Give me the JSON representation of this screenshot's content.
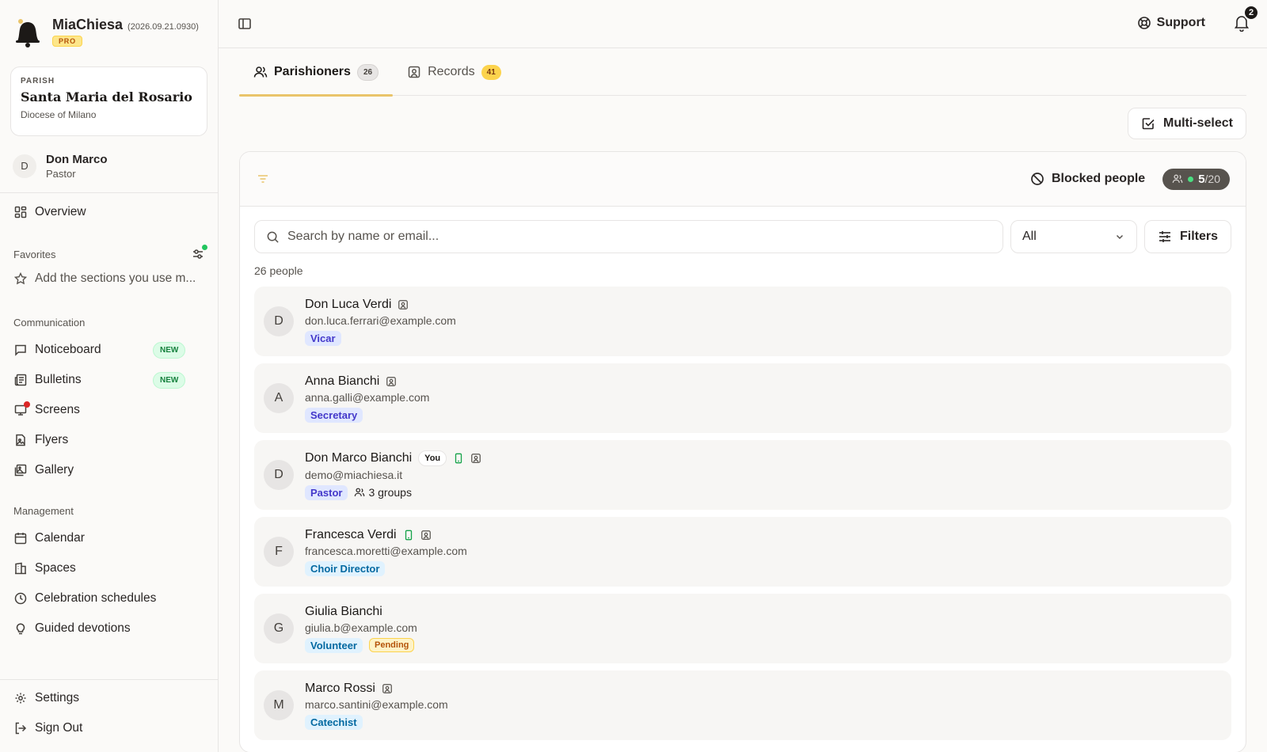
{
  "app": {
    "name": "MiaChiesa",
    "version": "(2026.09.21.0930)",
    "plan": "PRO"
  },
  "parish": {
    "label": "PARISH",
    "name": "Santa Maria del Rosario",
    "diocese": "Diocese of Milano"
  },
  "user": {
    "initial": "D",
    "name": "Don Marco",
    "role": "Pastor"
  },
  "sidebar": {
    "overview": "Overview",
    "favorites_label": "Favorites",
    "favorites_placeholder": "Add the sections you use m...",
    "communication_label": "Communication",
    "communication": [
      {
        "label": "Noticeboard",
        "badge": "NEW"
      },
      {
        "label": "Bulletins",
        "badge": "NEW"
      },
      {
        "label": "Screens"
      },
      {
        "label": "Flyers"
      },
      {
        "label": "Gallery"
      }
    ],
    "management_label": "Management",
    "management": [
      {
        "label": "Calendar"
      },
      {
        "label": "Spaces"
      },
      {
        "label": "Celebration schedules"
      },
      {
        "label": "Guided devotions"
      }
    ],
    "settings": "Settings",
    "sign_out": "Sign Out"
  },
  "topbar": {
    "support": "Support",
    "notifications": "2"
  },
  "tabs": [
    {
      "label": "Parishioners",
      "count": "26"
    },
    {
      "label": "Records",
      "count": "41"
    }
  ],
  "toolbar": {
    "multi_select": "Multi-select"
  },
  "panel": {
    "blocked_label": "Blocked people",
    "quota_used": "5",
    "quota_total": "/20",
    "search_placeholder": "Search by name or email...",
    "filter_value": "All",
    "filters_label": "Filters",
    "count_text": "26 people"
  },
  "people": [
    {
      "initial": "D",
      "name": "Don Luca Verdi",
      "email": "don.luca.ferrari@example.com",
      "role": "Vicar"
    },
    {
      "initial": "A",
      "name": "Anna Bianchi",
      "email": "anna.galli@example.com",
      "role": "Secretary"
    },
    {
      "initial": "D",
      "name": "Don Marco Bianchi",
      "you": "You",
      "email": "demo@miachiesa.it",
      "role": "Pastor",
      "groups": "3 groups"
    },
    {
      "initial": "F",
      "name": "Francesca Verdi",
      "email": "francesca.moretti@example.com",
      "role": "Choir Director"
    },
    {
      "initial": "G",
      "name": "Giulia Bianchi",
      "email": "giulia.b@example.com",
      "role": "Volunteer",
      "status": "Pending"
    },
    {
      "initial": "M",
      "name": "Marco Rossi",
      "email": "marco.santini@example.com",
      "role": "Catechist"
    }
  ],
  "colors": {
    "accent": "#e9c46a",
    "new_badge": "#15803d",
    "pending": "#b45309",
    "role_indigo": "#4338ca",
    "role_sky": "#0369a1",
    "online": "#4ade80"
  }
}
